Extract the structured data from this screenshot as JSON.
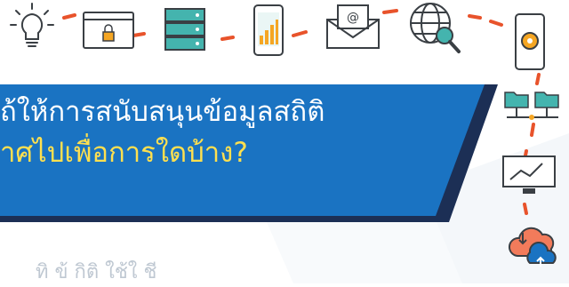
{
  "banner": {
    "line1": "ถ้ให้การสนับสนุนข้อมูลสถิติ",
    "line2": "าศไปเพื่อการใดบ้าง?"
  },
  "bottom_text": "ทิ  ข้   กิติ      ใช้ใ  ชี",
  "icons": {
    "lightbulb": "lightbulb-icon",
    "lock_window": "locked-browser-icon",
    "server": "server-icon",
    "phone_chart": "mobile-chart-icon",
    "email": "email-icon",
    "globe": "globe-search-icon",
    "phone_gear": "mobile-settings-icon",
    "network": "network-folders-icon",
    "monitor": "monitor-chart-icon",
    "cloud": "cloud-sync-icon"
  },
  "colors": {
    "banner_blue": "#1a73c2",
    "banner_dark": "#1c2f55",
    "accent_yellow": "#ffe04f",
    "dash_red": "#e8532b",
    "icon_teal": "#44b4ae",
    "icon_orange": "#f5a623",
    "outline": "#3a3f44"
  }
}
